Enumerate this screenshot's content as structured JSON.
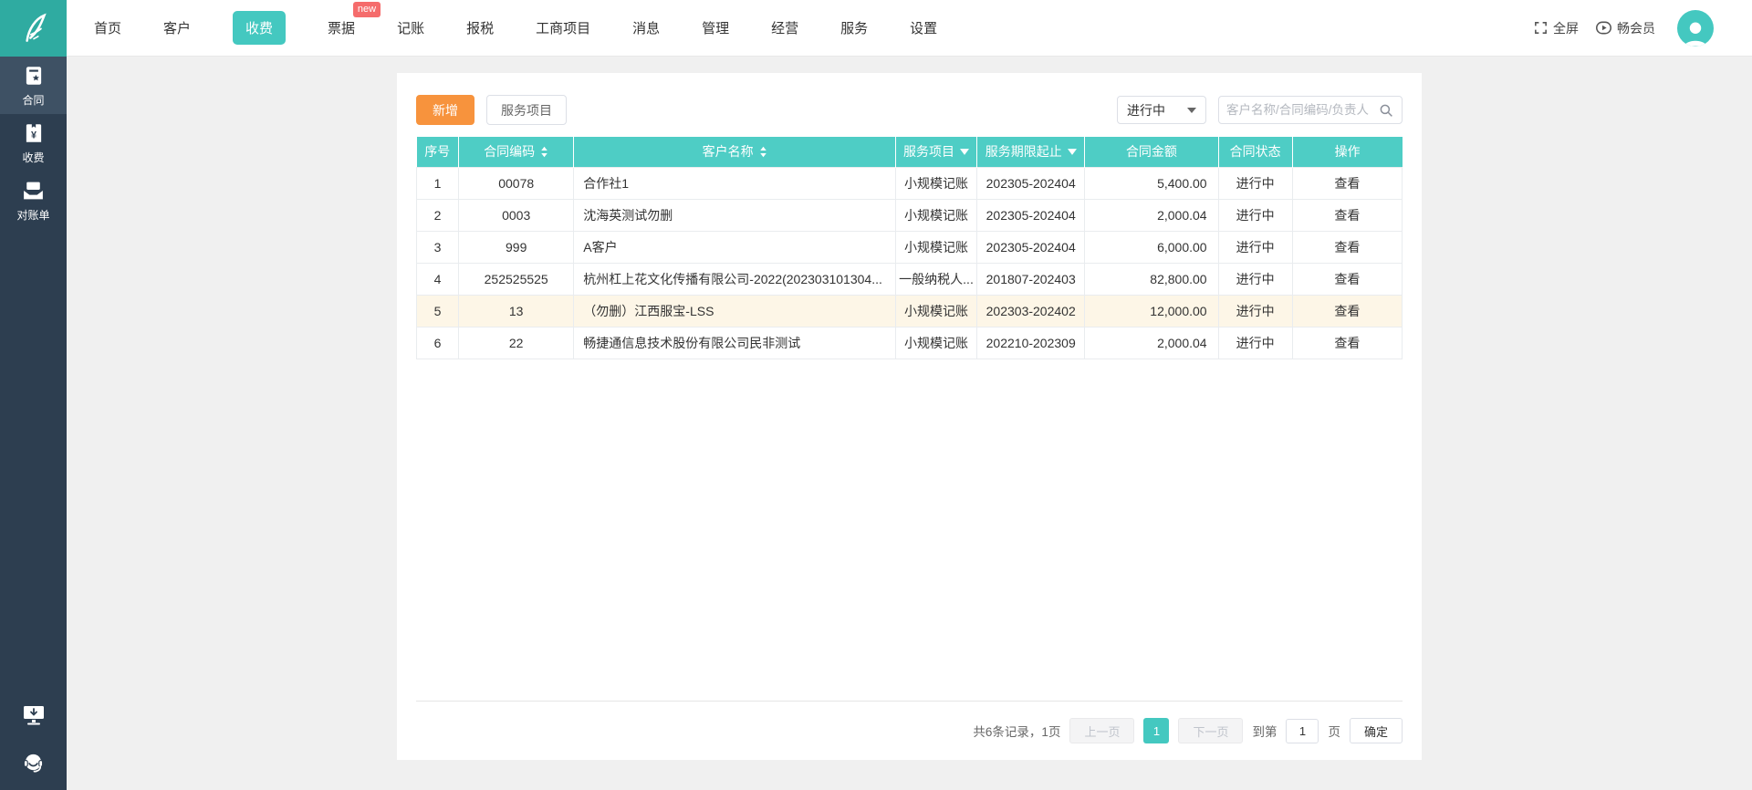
{
  "colors": {
    "brand_teal": "#44c8c0",
    "header_teal": "#4ecdc5",
    "logo_teal": "#2faba1",
    "sidebar_bg": "#2d3e50",
    "sidebar_active": "#3e5164",
    "accent_orange": "#f7933d",
    "badge_red": "#f56c6c",
    "row_highlight": "#fdf6e7"
  },
  "navbar": {
    "items": [
      {
        "label": "首页",
        "active": false,
        "badge": null
      },
      {
        "label": "客户",
        "active": false,
        "badge": null
      },
      {
        "label": "收费",
        "active": true,
        "badge": null
      },
      {
        "label": "票据",
        "active": false,
        "badge": "new"
      },
      {
        "label": "记账",
        "active": false,
        "badge": null
      },
      {
        "label": "报税",
        "active": false,
        "badge": null
      },
      {
        "label": "工商项目",
        "active": false,
        "badge": null
      },
      {
        "label": "消息",
        "active": false,
        "badge": null
      },
      {
        "label": "管理",
        "active": false,
        "badge": null
      },
      {
        "label": "经营",
        "active": false,
        "badge": null
      },
      {
        "label": "服务",
        "active": false,
        "badge": null
      },
      {
        "label": "设置",
        "active": false,
        "badge": null
      }
    ],
    "right": {
      "fullscreen_label": "全屏",
      "member_label": "畅会员"
    }
  },
  "sidebar": {
    "items": [
      {
        "label": "合同",
        "icon": "contract-icon",
        "active": true
      },
      {
        "label": "收费",
        "icon": "fee-icon",
        "active": false
      },
      {
        "label": "对账单",
        "icon": "statement-icon",
        "active": false
      }
    ],
    "bottom_icons": [
      "download-client-icon",
      "customer-service-icon"
    ]
  },
  "toolbar": {
    "add_label": "新增",
    "service_items_label": "服务项目",
    "status_filter_value": "进行中",
    "search_placeholder": "客户名称/合同编码/负责人"
  },
  "table": {
    "columns": [
      {
        "label": "序号",
        "sort": false,
        "filter": false
      },
      {
        "label": "合同编码",
        "sort": true,
        "filter": false
      },
      {
        "label": "客户名称",
        "sort": true,
        "filter": false
      },
      {
        "label": "服务项目",
        "sort": false,
        "filter": true
      },
      {
        "label": "服务期限起止",
        "sort": false,
        "filter": true
      },
      {
        "label": "合同金额",
        "sort": false,
        "filter": false
      },
      {
        "label": "合同状态",
        "sort": false,
        "filter": false
      },
      {
        "label": "操作",
        "sort": false,
        "filter": false
      }
    ],
    "rows": [
      {
        "seq": "1",
        "code": "00078",
        "customer": "合作社1",
        "service": "小规模记账",
        "period": "202305-202404",
        "amount": "5,400.00",
        "status": "进行中",
        "action": "查看",
        "highlight": false
      },
      {
        "seq": "2",
        "code": "0003",
        "customer": "沈海英测试勿删",
        "service": "小规模记账",
        "period": "202305-202404",
        "amount": "2,000.04",
        "status": "进行中",
        "action": "查看",
        "highlight": false
      },
      {
        "seq": "3",
        "code": "999",
        "customer": "A客户",
        "service": "小规模记账",
        "period": "202305-202404",
        "amount": "6,000.00",
        "status": "进行中",
        "action": "查看",
        "highlight": false
      },
      {
        "seq": "4",
        "code": "252525525",
        "customer": "杭州杠上花文化传播有限公司-2022(202303101304...",
        "service": "一般纳税人...",
        "period": "201807-202403",
        "amount": "82,800.00",
        "status": "进行中",
        "action": "查看",
        "highlight": false
      },
      {
        "seq": "5",
        "code": "13",
        "customer": "（勿删）江西服宝-LSS",
        "service": "小规模记账",
        "period": "202303-202402",
        "amount": "12,000.00",
        "status": "进行中",
        "action": "查看",
        "highlight": true
      },
      {
        "seq": "6",
        "code": "22",
        "customer": "畅捷通信息技术股份有限公司民非测试",
        "service": "小规模记账",
        "period": "202210-202309",
        "amount": "2,000.04",
        "status": "进行中",
        "action": "查看",
        "highlight": false
      }
    ]
  },
  "pagination": {
    "summary": "共6条记录，1页",
    "prev_label": "上一页",
    "current_page": "1",
    "next_label": "下一页",
    "goto_prefix": "到第",
    "goto_value": "1",
    "goto_suffix": "页",
    "confirm_label": "确定"
  },
  "icons": {
    "feather-logo-icon": "curved feather swoosh",
    "fullscreen-icon": "corner brackets ⛶",
    "member-play-icon": "rounded badge with play ▶",
    "avatar": "person silhouette 👤",
    "contract-icon": "document with star",
    "fee-icon": "booklet with ¥",
    "statement-icon": "letter into tray",
    "download-client-icon": "monitor with down arrow",
    "customer-service-icon": "headset smiley",
    "sort-icon": "▲▼",
    "filter-caret-icon": "▼",
    "dropdown-caret-icon": "▼",
    "search-icon": "magnifier 🔍"
  }
}
